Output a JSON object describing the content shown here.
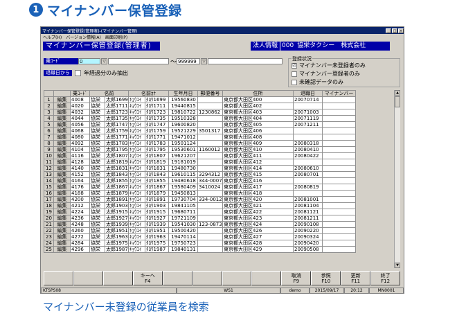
{
  "heading": {
    "number": "1",
    "text": "マイナンバー保管登録"
  },
  "caption": "マイナンバー未登録の従業員を検索",
  "window": {
    "title": "マイナンバー保管登録(管理者)-(マイナンバー管理)",
    "menu": [
      "ヘルプ(H)",
      "バージョン情報(A)",
      "画面印刷(P)"
    ],
    "controls": [
      "_",
      "□",
      "×"
    ]
  },
  "header": {
    "screen_title": "マイナンバー保管登録(管理者)",
    "company_label": "法人情報",
    "company_code": "000",
    "company_name": "協栄タクシー　株式会社"
  },
  "filters": {
    "code_label": "乗ｺｰﾄﾞ",
    "code_from": "0",
    "tilde": "～",
    "code_to": "999999",
    "dd_glyph": "▽",
    "retire_label": "退職日から",
    "retire_check": "年経過分のみ抽出"
  },
  "reg_status": {
    "title": "登録状況",
    "options": [
      {
        "label": "マイナンバー未登録者のみ",
        "mark": "☑"
      },
      {
        "label": "マイナンバー登録者のみ",
        "mark": ""
      },
      {
        "label": "未確認データのみ",
        "mark": ""
      }
    ]
  },
  "table": {
    "headers": [
      "",
      "",
      "乗ｺｰﾄﾞ",
      "名前",
      "名前ｶﾅ",
      "生年月日",
      "郵便番号",
      "住所",
      "退職日",
      "マイナンバー"
    ],
    "rows": [
      [
        "1",
        "編集",
        "4008",
        "協栄",
        "太郎1699",
        "ｷｮｳｴｲ",
        "ﾀﾛｳ1699",
        "19560830",
        "",
        "東京都大田区400",
        "20070714"
      ],
      [
        "2",
        "編集",
        "4020",
        "協栄",
        "太郎1711",
        "ｷｮｳｴｲ",
        "ﾀﾛｳ1711",
        "19440815",
        "",
        "東京都大田区402",
        ""
      ],
      [
        "3",
        "編集",
        "4032",
        "協栄",
        "太郎1723",
        "ｷｮｳｴｲ",
        "ﾀﾛｳ1723",
        "19810722",
        "1230862",
        "東京都大田区403",
        "20071003"
      ],
      [
        "4",
        "編集",
        "4044",
        "協栄",
        "太郎1735",
        "ｷｮｳｴｲ",
        "ﾀﾛｳ1735",
        "19510328",
        "",
        "東京都大田区404",
        "20071119"
      ],
      [
        "5",
        "編集",
        "4056",
        "協栄",
        "太郎1747",
        "ｷｮｳｴｲ",
        "ﾀﾛｳ1747",
        "19600820",
        "",
        "東京都大田区405",
        "20071211"
      ],
      [
        "6",
        "編集",
        "4068",
        "協栄",
        "太郎1759",
        "ｷｮｳｴｲ",
        "ﾀﾛｳ1759",
        "19521229",
        "3501317",
        "東京都大田区406",
        ""
      ],
      [
        "7",
        "編集",
        "4080",
        "協栄",
        "太郎1771",
        "ｷｮｳｴｲ",
        "ﾀﾛｳ1771",
        "19471012",
        "",
        "東京都大田区408",
        ""
      ],
      [
        "8",
        "編集",
        "4092",
        "協栄",
        "太郎1783",
        "ｷｮｳｴｲ",
        "ﾀﾛｳ1783",
        "19501124",
        "",
        "東京都大田区409",
        "20080318"
      ],
      [
        "9",
        "編集",
        "4104",
        "協栄",
        "太郎1795",
        "ｷｮｳｴｲ",
        "ﾀﾛｳ1795",
        "19530601",
        "1160012",
        "東京都大田区410",
        "20080410"
      ],
      [
        "10",
        "編集",
        "4116",
        "協栄",
        "太郎1807",
        "ｷｮｳｴｲ",
        "ﾀﾛｳ1807",
        "19621207",
        "",
        "東京都大田区411",
        "20080422"
      ],
      [
        "11",
        "編集",
        "4128",
        "協栄",
        "太郎1819",
        "ｷｮｳｴｲ",
        "ﾀﾛｳ1819",
        "19181019",
        "",
        "東京都大田区412",
        ""
      ],
      [
        "12",
        "編集",
        "4140",
        "協栄",
        "太郎1831",
        "ｷｮｳｴｲ",
        "ﾀﾛｳ1831",
        "19480730",
        "",
        "東京都大田区414",
        "20080610"
      ],
      [
        "13",
        "編集",
        "4152",
        "協栄",
        "太郎1843",
        "ｷｮｳｴｲ",
        "ﾀﾛｳ1843",
        "19610115",
        "3294312",
        "東京都大田区415",
        "20080701"
      ],
      [
        "14",
        "編集",
        "4164",
        "協栄",
        "太郎1855",
        "ｷｮｳｴｲ",
        "ﾀﾛｳ1855",
        "19480618",
        "344-0007",
        "東京都大田区416",
        ""
      ],
      [
        "15",
        "編集",
        "4176",
        "協栄",
        "太郎1867",
        "ｷｮｳｴｲ",
        "ﾀﾛｳ1867",
        "19580409",
        "3410024",
        "東京都大田区417",
        "20080819"
      ],
      [
        "16",
        "編集",
        "4188",
        "協栄",
        "太郎1879",
        "ｷｮｳｴｲ",
        "ﾀﾛｳ1879",
        "19450813",
        "",
        "東京都大田区418",
        ""
      ],
      [
        "17",
        "編集",
        "4200",
        "協栄",
        "太郎1891",
        "ｷｮｳｴｲ",
        "ﾀﾛｳ1891",
        "19730704",
        "334-0012",
        "東京都大田区420",
        "20081001"
      ],
      [
        "18",
        "編集",
        "4212",
        "協栄",
        "太郎1903",
        "ｷｮｳｴｲ",
        "ﾀﾛｳ1903",
        "19841105",
        "",
        "東京都大田区421",
        "20081104"
      ],
      [
        "19",
        "編集",
        "4224",
        "協栄",
        "太郎1915",
        "ｷｮｳｴｲ",
        "ﾀﾛｳ1915",
        "19680711",
        "",
        "東京都大田区422",
        "20081121"
      ],
      [
        "20",
        "編集",
        "4236",
        "協栄",
        "太郎1927",
        "ｷｮｳｴｲ",
        "ﾀﾛｳ1927",
        "19721109",
        "",
        "東京都大田区423",
        "20081211"
      ],
      [
        "21",
        "編集",
        "4248",
        "協栄",
        "太郎1939",
        "ｷｮｳｴｲ",
        "ﾀﾛｳ1939",
        "19541030",
        "123-0873",
        "東京都大田区424",
        "20090108"
      ],
      [
        "22",
        "編集",
        "4260",
        "協栄",
        "太郎1951",
        "ｷｮｳｴｲ",
        "ﾀﾛｳ1951",
        "19500420",
        "",
        "東京都大田区426",
        "20090220"
      ],
      [
        "23",
        "編集",
        "4272",
        "協栄",
        "太郎1963",
        "ｷｮｳｴｲ",
        "ﾀﾛｳ1963",
        "19470114",
        "",
        "東京都大田区427",
        "20090324"
      ],
      [
        "24",
        "編集",
        "4284",
        "協栄",
        "太郎1975",
        "ｷｮｳｴｲ",
        "ﾀﾛｳ1975",
        "19750723",
        "",
        "東京都大田区428",
        "20090420"
      ],
      [
        "25",
        "編集",
        "4296",
        "協栄",
        "太郎1987",
        "ｷｮｳｴｲ",
        "ﾀﾛｳ1987",
        "19840131",
        "",
        "東京都大田区429",
        "20090508"
      ]
    ]
  },
  "fkeys": [
    {
      "label": "",
      "key": ""
    },
    {
      "label": "",
      "key": ""
    },
    {
      "label": "",
      "key": ""
    },
    {
      "label": "キーへ",
      "key": "F4"
    },
    {
      "label": "",
      "key": ""
    },
    {
      "label": "",
      "key": ""
    },
    {
      "label": "",
      "key": ""
    },
    {
      "label": "",
      "key": ""
    },
    {
      "label": "取消",
      "key": "F9"
    },
    {
      "label": "参照",
      "key": "F10"
    },
    {
      "label": "更新",
      "key": "F11"
    },
    {
      "label": "終了",
      "key": "F12"
    }
  ],
  "status_bar": {
    "screen_id": "KTSPS08",
    "terminal": "WS1",
    "user": "demo",
    "date": "2015/09/17",
    "time": "20:12",
    "code": "MN0001"
  },
  "colors": {
    "accent": "#1b62b8",
    "title_bar": "#0a246a",
    "label_bg": "#0000a8"
  }
}
